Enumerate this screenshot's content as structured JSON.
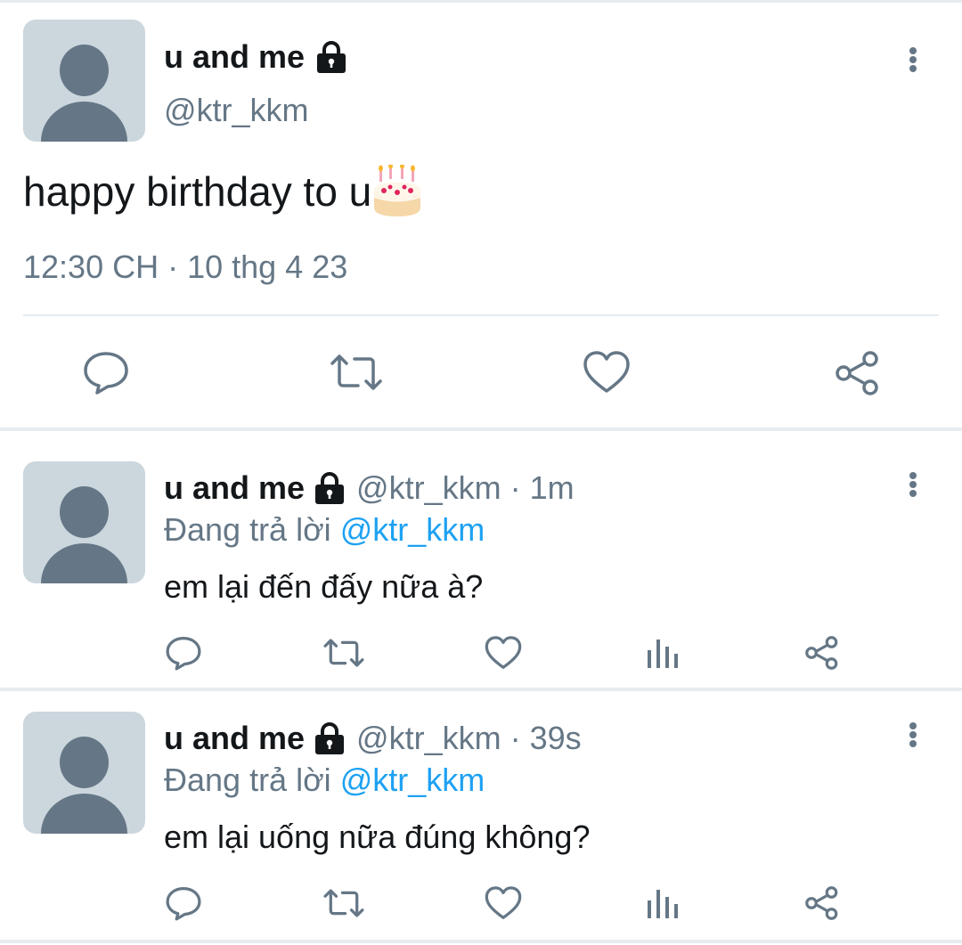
{
  "main_tweet": {
    "display_name": "u and me",
    "handle": "@ktr_kkm",
    "text": "happy birthday to u",
    "emoji": "cake-emoji",
    "timestamp": "12:30 CH · 10 thg 4 23",
    "actions": [
      "reply-icon",
      "retweet-icon",
      "like-icon",
      "share-icon"
    ]
  },
  "replies": [
    {
      "display_name": "u and me",
      "handle": "@ktr_kkm",
      "separator": "·",
      "time": "1m",
      "replying_label": "Đang trả lời",
      "replying_to": "@ktr_kkm",
      "text": "em lại đến đấy nữa à?"
    },
    {
      "display_name": "u and me",
      "handle": "@ktr_kkm",
      "separator": "·",
      "time": "39s",
      "replying_label": "Đang trả lời",
      "replying_to": "@ktr_kkm",
      "text": "em lại uống nữa đúng không?"
    }
  ],
  "colors": {
    "text_primary": "#14171a",
    "text_secondary": "#657786",
    "link": "#1da1f2",
    "divider": "#e6ecf0",
    "avatar_bg": "#ccd6dd"
  }
}
